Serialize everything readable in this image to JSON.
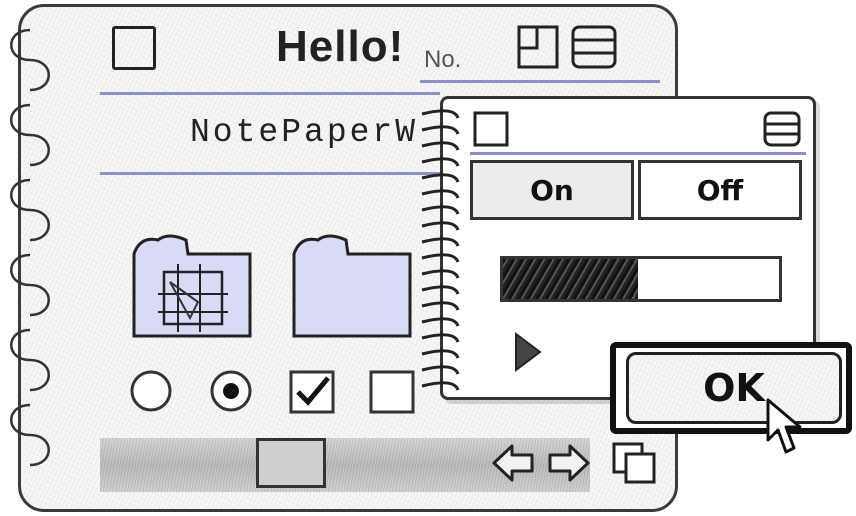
{
  "back_window": {
    "title": "Hello!",
    "no_label": "No.",
    "subtitle": "NotePaperW",
    "icons": [
      "close-box-icon",
      "zoom-icon",
      "collapse-icon"
    ],
    "folders": [
      "folder-with-grid-icon",
      "folder-icon"
    ],
    "controls": [
      "radio-off",
      "radio-on",
      "checkbox-checked",
      "checkbox-empty"
    ],
    "bottom_icons": [
      "left-arrow-icon",
      "right-arrow-icon",
      "copy-folder-icon"
    ]
  },
  "front_window": {
    "segments": [
      "On",
      "Off"
    ],
    "progress": 0.49,
    "icons": [
      "close-box-icon",
      "collapse-icon",
      "play-icon"
    ]
  },
  "ok_button": {
    "label": "OK"
  },
  "colors": {
    "accent": "#8c90c4",
    "fill": "#d9dbf6",
    "ink": "#222222"
  }
}
